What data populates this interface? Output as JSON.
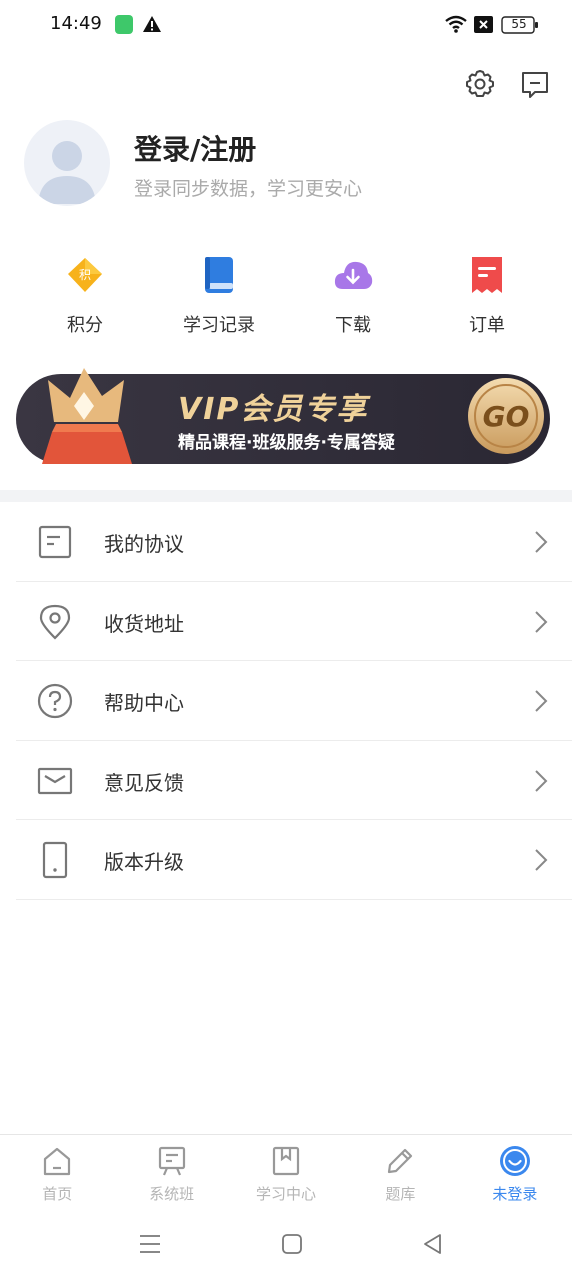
{
  "status_bar": {
    "time": "14:49",
    "battery": "55"
  },
  "profile": {
    "title": "登录/注册",
    "subtitle": "登录同步数据，学习更安心"
  },
  "quick_actions": [
    {
      "label": "积分",
      "icon": "points-diamond-icon",
      "badge": "积"
    },
    {
      "label": "学习记录",
      "icon": "study-record-book-icon"
    },
    {
      "label": "下载",
      "icon": "download-cloud-icon"
    },
    {
      "label": "订单",
      "icon": "order-receipt-icon"
    }
  ],
  "vip_banner": {
    "title": "VIP会员专享",
    "subtitle": "精品课程·班级服务·专属答疑",
    "go_label": "GO"
  },
  "menu": [
    {
      "label": "我的协议",
      "icon": "document-icon"
    },
    {
      "label": "收货地址",
      "icon": "location-pin-icon"
    },
    {
      "label": "帮助中心",
      "icon": "help-circle-icon"
    },
    {
      "label": "意见反馈",
      "icon": "envelope-icon"
    },
    {
      "label": "版本升级",
      "icon": "phone-icon"
    }
  ],
  "tabs": [
    {
      "label": "首页",
      "icon": "home-icon",
      "active": false
    },
    {
      "label": "系统班",
      "icon": "classroom-board-icon",
      "active": false
    },
    {
      "label": "学习中心",
      "icon": "bookmark-book-icon",
      "active": false
    },
    {
      "label": "题库",
      "icon": "pencil-icon",
      "active": false
    },
    {
      "label": "未登录",
      "icon": "smile-face-icon",
      "active": true
    }
  ],
  "colors": {
    "accent": "#3b88ee",
    "muted": "#b5b5b5",
    "vip_bg": "#2e2b36",
    "vip_gold": "#e8c38a"
  }
}
